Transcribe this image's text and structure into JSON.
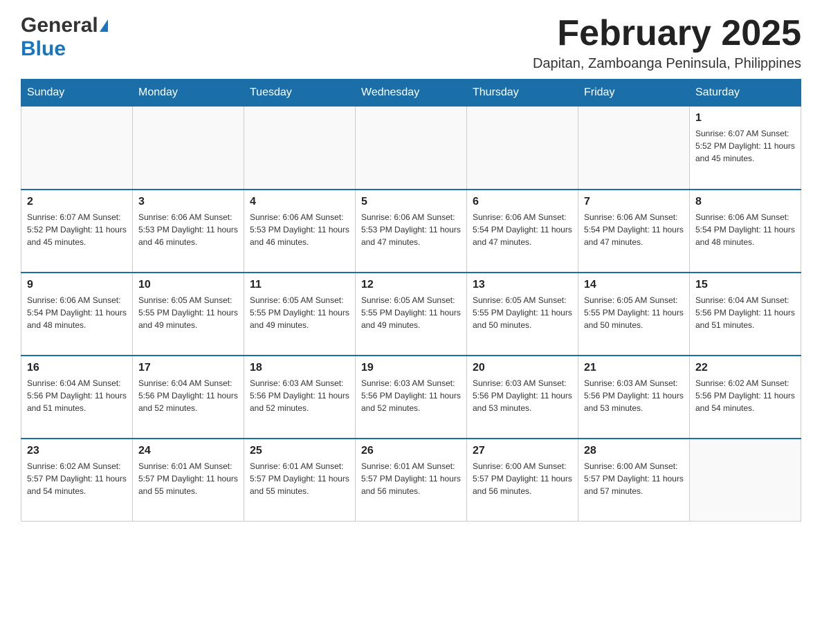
{
  "logo": {
    "general": "General",
    "blue": "Blue"
  },
  "header": {
    "month_year": "February 2025",
    "location": "Dapitan, Zamboanga Peninsula, Philippines"
  },
  "days_of_week": [
    "Sunday",
    "Monday",
    "Tuesday",
    "Wednesday",
    "Thursday",
    "Friday",
    "Saturday"
  ],
  "weeks": [
    {
      "days": [
        {
          "date": "",
          "info": ""
        },
        {
          "date": "",
          "info": ""
        },
        {
          "date": "",
          "info": ""
        },
        {
          "date": "",
          "info": ""
        },
        {
          "date": "",
          "info": ""
        },
        {
          "date": "",
          "info": ""
        },
        {
          "date": "1",
          "info": "Sunrise: 6:07 AM\nSunset: 5:52 PM\nDaylight: 11 hours and 45 minutes."
        }
      ]
    },
    {
      "days": [
        {
          "date": "2",
          "info": "Sunrise: 6:07 AM\nSunset: 5:52 PM\nDaylight: 11 hours and 45 minutes."
        },
        {
          "date": "3",
          "info": "Sunrise: 6:06 AM\nSunset: 5:53 PM\nDaylight: 11 hours and 46 minutes."
        },
        {
          "date": "4",
          "info": "Sunrise: 6:06 AM\nSunset: 5:53 PM\nDaylight: 11 hours and 46 minutes."
        },
        {
          "date": "5",
          "info": "Sunrise: 6:06 AM\nSunset: 5:53 PM\nDaylight: 11 hours and 47 minutes."
        },
        {
          "date": "6",
          "info": "Sunrise: 6:06 AM\nSunset: 5:54 PM\nDaylight: 11 hours and 47 minutes."
        },
        {
          "date": "7",
          "info": "Sunrise: 6:06 AM\nSunset: 5:54 PM\nDaylight: 11 hours and 47 minutes."
        },
        {
          "date": "8",
          "info": "Sunrise: 6:06 AM\nSunset: 5:54 PM\nDaylight: 11 hours and 48 minutes."
        }
      ]
    },
    {
      "days": [
        {
          "date": "9",
          "info": "Sunrise: 6:06 AM\nSunset: 5:54 PM\nDaylight: 11 hours and 48 minutes."
        },
        {
          "date": "10",
          "info": "Sunrise: 6:05 AM\nSunset: 5:55 PM\nDaylight: 11 hours and 49 minutes."
        },
        {
          "date": "11",
          "info": "Sunrise: 6:05 AM\nSunset: 5:55 PM\nDaylight: 11 hours and 49 minutes."
        },
        {
          "date": "12",
          "info": "Sunrise: 6:05 AM\nSunset: 5:55 PM\nDaylight: 11 hours and 49 minutes."
        },
        {
          "date": "13",
          "info": "Sunrise: 6:05 AM\nSunset: 5:55 PM\nDaylight: 11 hours and 50 minutes."
        },
        {
          "date": "14",
          "info": "Sunrise: 6:05 AM\nSunset: 5:55 PM\nDaylight: 11 hours and 50 minutes."
        },
        {
          "date": "15",
          "info": "Sunrise: 6:04 AM\nSunset: 5:56 PM\nDaylight: 11 hours and 51 minutes."
        }
      ]
    },
    {
      "days": [
        {
          "date": "16",
          "info": "Sunrise: 6:04 AM\nSunset: 5:56 PM\nDaylight: 11 hours and 51 minutes."
        },
        {
          "date": "17",
          "info": "Sunrise: 6:04 AM\nSunset: 5:56 PM\nDaylight: 11 hours and 52 minutes."
        },
        {
          "date": "18",
          "info": "Sunrise: 6:03 AM\nSunset: 5:56 PM\nDaylight: 11 hours and 52 minutes."
        },
        {
          "date": "19",
          "info": "Sunrise: 6:03 AM\nSunset: 5:56 PM\nDaylight: 11 hours and 52 minutes."
        },
        {
          "date": "20",
          "info": "Sunrise: 6:03 AM\nSunset: 5:56 PM\nDaylight: 11 hours and 53 minutes."
        },
        {
          "date": "21",
          "info": "Sunrise: 6:03 AM\nSunset: 5:56 PM\nDaylight: 11 hours and 53 minutes."
        },
        {
          "date": "22",
          "info": "Sunrise: 6:02 AM\nSunset: 5:56 PM\nDaylight: 11 hours and 54 minutes."
        }
      ]
    },
    {
      "days": [
        {
          "date": "23",
          "info": "Sunrise: 6:02 AM\nSunset: 5:57 PM\nDaylight: 11 hours and 54 minutes."
        },
        {
          "date": "24",
          "info": "Sunrise: 6:01 AM\nSunset: 5:57 PM\nDaylight: 11 hours and 55 minutes."
        },
        {
          "date": "25",
          "info": "Sunrise: 6:01 AM\nSunset: 5:57 PM\nDaylight: 11 hours and 55 minutes."
        },
        {
          "date": "26",
          "info": "Sunrise: 6:01 AM\nSunset: 5:57 PM\nDaylight: 11 hours and 56 minutes."
        },
        {
          "date": "27",
          "info": "Sunrise: 6:00 AM\nSunset: 5:57 PM\nDaylight: 11 hours and 56 minutes."
        },
        {
          "date": "28",
          "info": "Sunrise: 6:00 AM\nSunset: 5:57 PM\nDaylight: 11 hours and 57 minutes."
        },
        {
          "date": "",
          "info": ""
        }
      ]
    }
  ]
}
